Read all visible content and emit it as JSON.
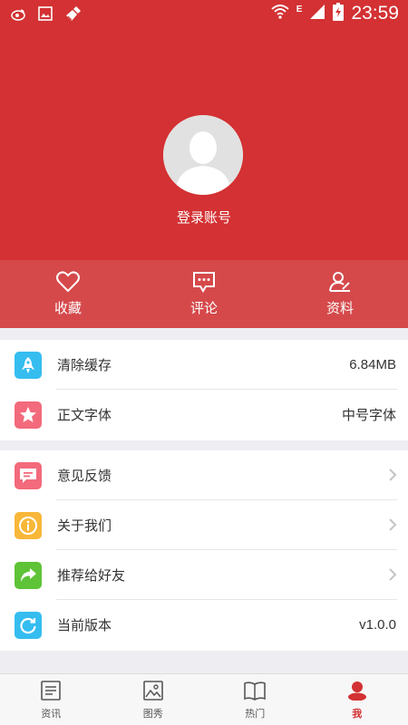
{
  "colors": {
    "brand": "#d33133",
    "action_bar": "#d5494b",
    "clear_cache": "#35bdf0",
    "font": "#f36a7c",
    "feedback": "#f36a7c",
    "about": "#f8b739",
    "recommend": "#5ec337",
    "version": "#35bdf0"
  },
  "status_bar": {
    "time": "23:59",
    "network_label": "E",
    "icons": [
      "weibo-icon",
      "image-icon",
      "broom-icon",
      "wifi-icon",
      "signal-icon",
      "battery-icon"
    ]
  },
  "profile": {
    "login_label": "登录账号",
    "avatar_icon": "default-avatar-icon"
  },
  "actions": [
    {
      "label": "收藏",
      "icon": "heart-icon"
    },
    {
      "label": "评论",
      "icon": "comment-icon"
    },
    {
      "label": "资料",
      "icon": "profile-edit-icon"
    }
  ],
  "settings": {
    "clear_cache": {
      "label": "清除缓存",
      "value": "6.84MB",
      "icon": "rocket-icon"
    },
    "body_font": {
      "label": "正文字体",
      "value": "中号字体",
      "icon": "star-icon"
    },
    "feedback": {
      "label": "意见反馈",
      "icon": "message-icon"
    },
    "about": {
      "label": "关于我们",
      "icon": "info-icon"
    },
    "recommend": {
      "label": "推荐给好友",
      "icon": "share-icon"
    },
    "version": {
      "label": "当前版本",
      "value": "v1.0.0",
      "icon": "refresh-icon"
    }
  },
  "bottom_nav": [
    {
      "label": "资讯",
      "icon": "news-icon",
      "active": false
    },
    {
      "label": "图秀",
      "icon": "picture-icon",
      "active": false
    },
    {
      "label": "热门",
      "icon": "book-icon",
      "active": false
    },
    {
      "label": "我",
      "icon": "user-icon",
      "active": true
    }
  ]
}
